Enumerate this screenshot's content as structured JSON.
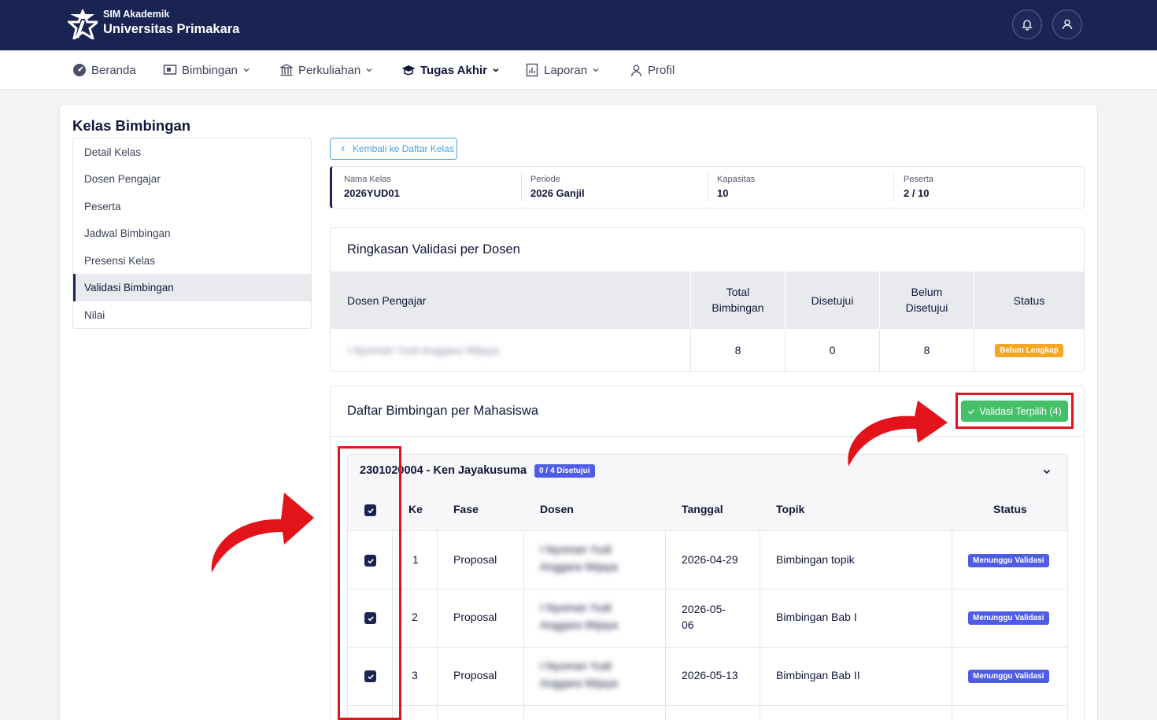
{
  "header": {
    "app_sub": "SIM Akademik",
    "app_name": "Universitas Primakara",
    "icons": [
      "bell-icon",
      "user-icon"
    ]
  },
  "nav": {
    "items": [
      {
        "label": "Beranda",
        "icon": "dashboard-icon"
      },
      {
        "label": "Bimbingan",
        "icon": "presentation-icon"
      },
      {
        "label": "Perkuliahan",
        "icon": "building-icon"
      },
      {
        "label": "Tugas Akhir",
        "icon": "graduation-cap-icon"
      },
      {
        "label": "Laporan",
        "icon": "report-icon"
      },
      {
        "label": "Profil",
        "icon": "user-icon"
      }
    ],
    "active": "Tugas Akhir"
  },
  "page": {
    "title": "Kelas Bimbingan"
  },
  "sidebar": {
    "items": [
      {
        "label": "Detail Kelas"
      },
      {
        "label": "Dosen Pengajar"
      },
      {
        "label": "Peserta"
      },
      {
        "label": "Jadwal Bimbingan"
      },
      {
        "label": "Presensi Kelas"
      },
      {
        "label": "Validasi Bimbingan"
      },
      {
        "label": "Nilai"
      }
    ],
    "active": "Validasi Bimbingan"
  },
  "back_button": {
    "label": "Kembali ke Daftar Kelas"
  },
  "info": {
    "nama_kelas": {
      "label": "Nama Kelas",
      "value": "2026YUD01"
    },
    "periode": {
      "label": "Periode",
      "value": "2026 Ganjil"
    },
    "kapasitas": {
      "label": "Kapasitas",
      "value": "10"
    },
    "peserta": {
      "label": "Peserta",
      "value": "2 / 10"
    }
  },
  "summary": {
    "title": "Ringkasan Validasi per Dosen",
    "columns": {
      "dosen": "Dosen Pengajar",
      "total_1": "Total",
      "total_2": "Bimbingan",
      "disetujui": "Disetujui",
      "belum_1": "Belum",
      "belum_2": "Disetujui",
      "status": "Status"
    },
    "row": {
      "dosen": "I Nyoman Yudi Anggara Wijaya",
      "total": "8",
      "disetujui": "0",
      "belum": "8",
      "status": "Belum Lengkap"
    }
  },
  "list": {
    "title": "Daftar Bimbingan per Mahasiswa",
    "validate_button": "Validasi Terpilih (4)",
    "group": {
      "student": "2301020004 - Ken Jayakusuma",
      "badge": "0 / 4 Disetujui"
    },
    "columns": {
      "ke": "Ke",
      "fase": "Fase",
      "dosen": "Dosen",
      "tanggal": "Tanggal",
      "topik": "Topik",
      "status": "Status"
    },
    "rows": [
      {
        "ke": "1",
        "fase": "Proposal",
        "dosen_1": "I Nyoman Yudi",
        "dosen_2": "Anggara Wijaya",
        "tanggal_1": "2026-04-29",
        "tanggal_2": "",
        "topik": "Bimbingan topik",
        "status": "Menunggu Validasi",
        "checked": true
      },
      {
        "ke": "2",
        "fase": "Proposal",
        "dosen_1": "I Nyoman Yudi",
        "dosen_2": "Anggara Wijaya",
        "tanggal_1": "2026-05-",
        "tanggal_2": "06",
        "topik": "Bimbingan Bab I",
        "status": "Menunggu Validasi",
        "checked": true
      },
      {
        "ke": "3",
        "fase": "Proposal",
        "dosen_1": "I Nyoman Yudi",
        "dosen_2": "Anggara Wijaya",
        "tanggal_1": "2026-05-13",
        "tanggal_2": "",
        "topik": "Bimbingan Bab II",
        "status": "Menunggu Validasi",
        "checked": true
      }
    ]
  },
  "colors": {
    "header_bg": "#1a2452",
    "accent_green": "#45c06a",
    "badge_warning": "#f5a623",
    "badge_primary": "#4f5de6",
    "annotation_red": "#e3131c"
  }
}
